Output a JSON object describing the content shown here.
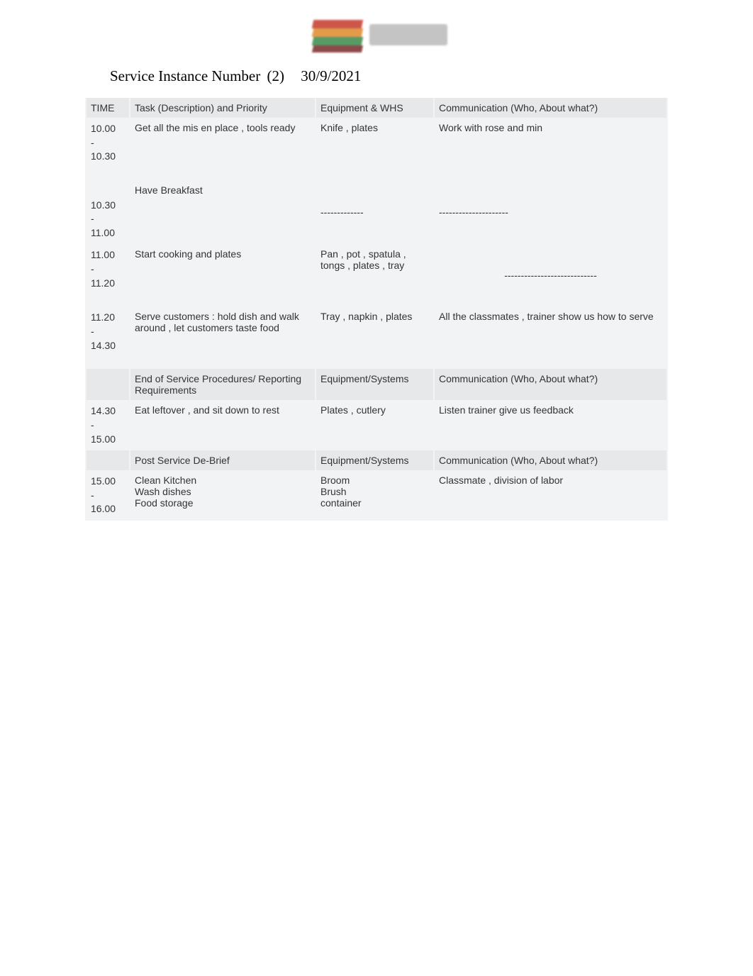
{
  "header": {
    "title_label": "Service Instance Number",
    "instance_number": "(2)",
    "date": "30/9/2021"
  },
  "columns": {
    "time": "TIME",
    "task": "Task (Description) and Priority",
    "equipment": "Equipment & WHS",
    "communication": "Communication (Who, About what?)"
  },
  "rows": [
    {
      "time": "10.00 - 10.30",
      "task": "Get all the mis en place , tools ready",
      "equipment": "Knife , plates",
      "communication": "Work with rose and min"
    },
    {
      "time": "10.30 - 11.00",
      "task": "Have Breakfast",
      "equipment": "-------------",
      "communication": "---------------------"
    },
    {
      "time": "11.00 - 11.20",
      "task": "Start cooking and plates",
      "equipment": "Pan , pot , spatula , tongs , plates , tray",
      "communication": "----------------------------"
    },
    {
      "time": "11.20 - 14.30",
      "task": "Serve customers : hold dish and walk around , let customers taste food",
      "equipment": "Tray , napkin , plates",
      "communication": "All the classmates , trainer show us how to serve"
    }
  ],
  "section_eos": {
    "subhead_task": "End of Service Procedures/ Reporting Requirements",
    "subhead_equip": "Equipment/Systems",
    "subhead_comm": "Communication (Who, About what?)",
    "time": "14.30 - 15.00",
    "task": "Eat leftover , and sit down to rest",
    "equipment": "Plates , cutlery",
    "communication": "Listen trainer give us feedback"
  },
  "section_post": {
    "subhead_task": "Post Service De-Brief",
    "subhead_equip": "Equipment/Systems",
    "subhead_comm": "Communication (Who, About what?)",
    "time": "15.00 - 16.00",
    "task": "Clean Kitchen\nWash dishes\nFood storage",
    "equipment": "Broom\nBrush\ncontainer",
    "communication": "Classmate , division of labor"
  }
}
